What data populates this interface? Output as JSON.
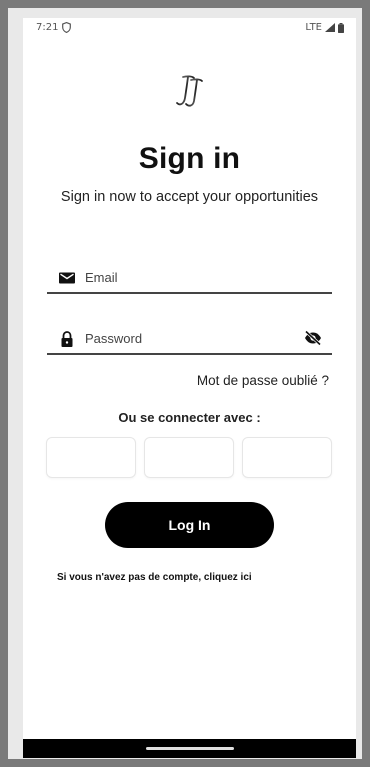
{
  "status_bar": {
    "time": "7:21",
    "network": "LTE",
    "icons": [
      "shield-icon",
      "signal-icon",
      "battery-icon"
    ]
  },
  "logo": {
    "text": "JJ"
  },
  "header": {
    "title": "Sign in",
    "subtitle": "Sign in now to accept your opportunities"
  },
  "form": {
    "email": {
      "placeholder": "Email",
      "value": "",
      "icon": "mail-icon"
    },
    "password": {
      "placeholder": "Password",
      "value": "",
      "icon": "lock-icon",
      "toggle_icon": "eye-off-icon"
    },
    "forgot_label": "Mot de passe oublié ?",
    "or_connect_label": "Ou se connecter avec :",
    "social_buttons": [
      "",
      "",
      ""
    ],
    "login_label": "Log In",
    "signup_label": "Si vous n'avez pas de compte, cliquez ici"
  },
  "colors": {
    "primary": "#000000",
    "background": "#ffffff",
    "frame": "#7a7a7a"
  }
}
